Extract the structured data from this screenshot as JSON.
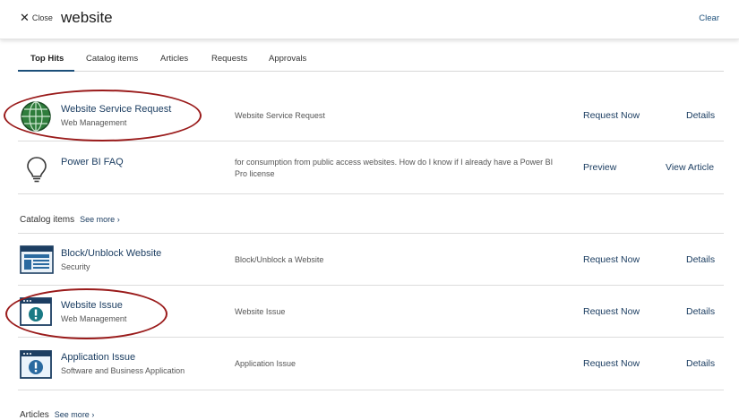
{
  "header": {
    "close_label": "Close",
    "search_term": "website",
    "clear_label": "Clear"
  },
  "tabs": [
    {
      "label": "Top Hits",
      "active": true
    },
    {
      "label": "Catalog items",
      "active": false
    },
    {
      "label": "Articles",
      "active": false
    },
    {
      "label": "Requests",
      "active": false
    },
    {
      "label": "Approvals",
      "active": false
    }
  ],
  "top_hits": [
    {
      "icon": "globe-icon",
      "title": "Website Service Request",
      "subtitle": "Web Management",
      "description": "Website Service Request",
      "primary_action": "Request Now",
      "secondary_action": "Details"
    },
    {
      "icon": "lightbulb-icon",
      "title": "Power BI FAQ",
      "subtitle": "",
      "description": "for consumption from public access websites. How do I know if I already have a Power BI Pro license",
      "primary_action": "Preview",
      "secondary_action": "View Article"
    }
  ],
  "catalog_section": {
    "title": "Catalog items",
    "see_more": "See more"
  },
  "catalog_items": [
    {
      "icon": "webpage-layout-icon",
      "title": "Block/Unblock Website",
      "subtitle": "Security",
      "description": "Block/Unblock a Website",
      "primary_action": "Request Now",
      "secondary_action": "Details"
    },
    {
      "icon": "browser-alert-icon",
      "title": "Website Issue",
      "subtitle": "Web Management",
      "description": "Website Issue",
      "primary_action": "Request Now",
      "secondary_action": "Details"
    },
    {
      "icon": "browser-alert-icon",
      "title": "Application Issue",
      "subtitle": "Software and Business Application",
      "description": "Application Issue",
      "primary_action": "Request Now",
      "secondary_action": "Details"
    }
  ],
  "articles_section": {
    "title": "Articles",
    "see_more": "See more"
  },
  "colors": {
    "link": "#1c3e62",
    "highlight_ellipse": "#9a1b1b",
    "globe": "#2f7d3c",
    "icon_navy": "#1c3e62",
    "icon_teal": "#1a7a85"
  }
}
